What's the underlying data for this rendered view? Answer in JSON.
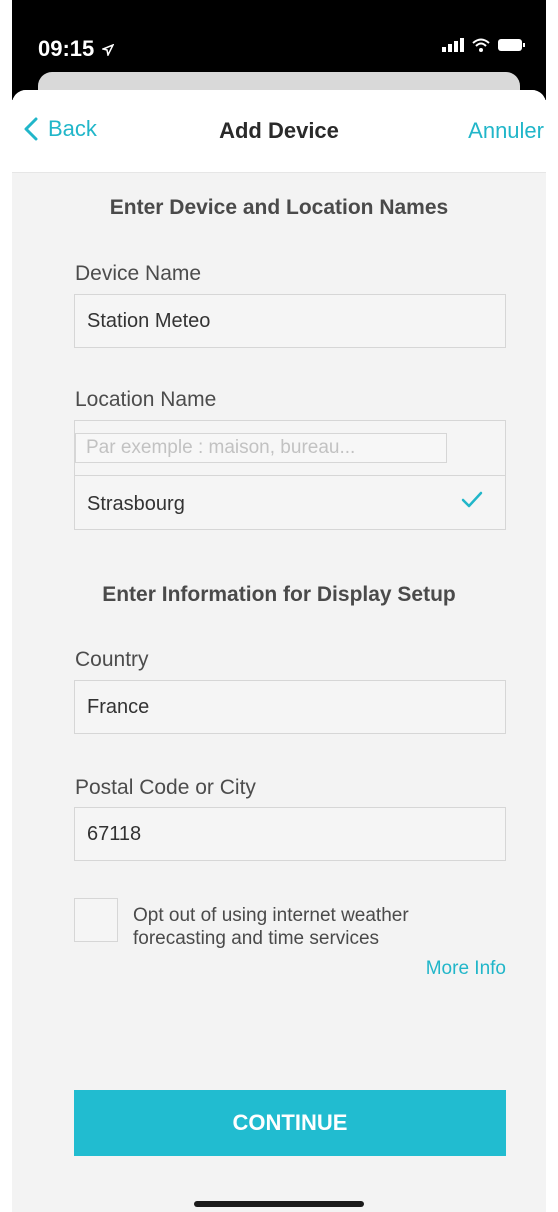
{
  "status_bar": {
    "time": "09:15"
  },
  "nav": {
    "back_label": "Back",
    "title": "Add Device",
    "cancel_label": "Annuler"
  },
  "section1": {
    "title": "Enter Device and Location Names"
  },
  "device_name": {
    "label": "Device Name",
    "value": "Station Meteo"
  },
  "location": {
    "label": "Location Name",
    "placeholder": "Par exemple : maison, bureau...",
    "selected_option": "Strasbourg"
  },
  "section2": {
    "title": "Enter Information for Display Setup"
  },
  "country": {
    "label": "Country",
    "value": "France"
  },
  "postal": {
    "label": "Postal Code or City",
    "value": "67118"
  },
  "opt_out": {
    "line1": "Opt out of using internet weather",
    "line2": "forecasting and time services",
    "checked": false,
    "more_info_label": "More Info"
  },
  "continue_label": "CONTINUE",
  "colors": {
    "accent": "#21bcd0",
    "link": "#21b6c9"
  },
  "icons": [
    "location-arrow-icon",
    "signal-icon",
    "wifi-icon",
    "battery-icon",
    "chevron-left-icon",
    "checkmark-icon"
  ]
}
